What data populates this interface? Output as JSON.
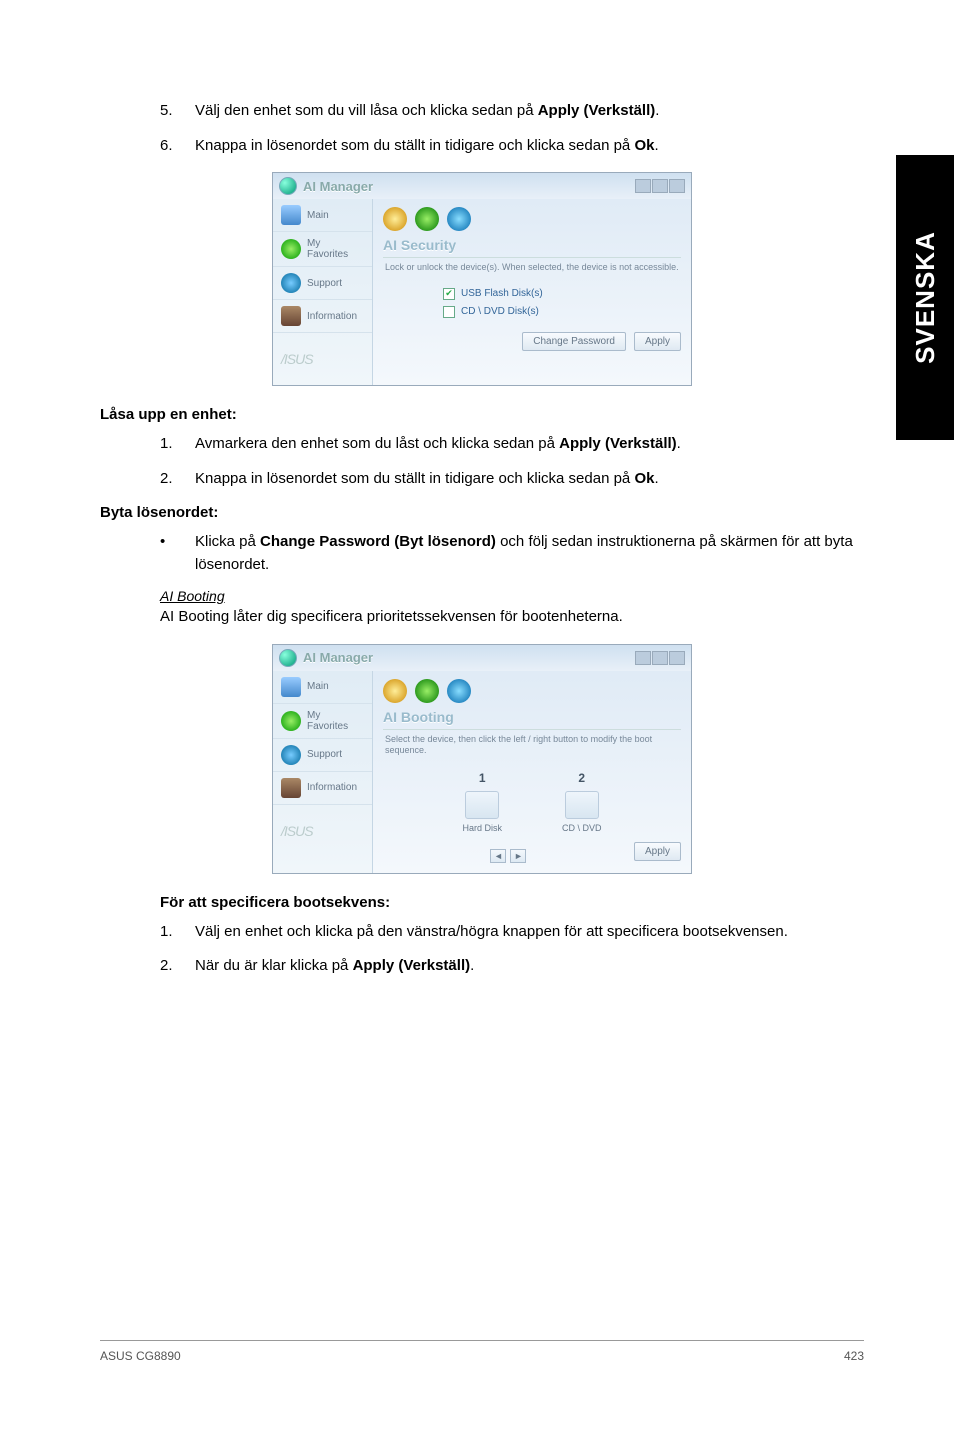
{
  "side_tab": "SVENSKA",
  "steps_top": [
    {
      "num": "5.",
      "pre": "Välj den enhet som du vill låsa och klicka sedan på ",
      "bold": "Apply (Verkställ)",
      "post": "."
    },
    {
      "num": "6.",
      "pre": "Knappa in lösenordet som du ställt in tidigare och klicka sedan på ",
      "bold": "Ok",
      "post": "."
    }
  ],
  "heading_unlock": "Låsa upp en enhet:",
  "steps_unlock": [
    {
      "num": "1.",
      "pre": "Avmarkera den enhet som du låst och klicka sedan på ",
      "bold": "Apply (Verkställ)",
      "post": "."
    },
    {
      "num": "2.",
      "pre": "Knappa in lösenordet som du ställt in tidigare och klicka sedan på ",
      "bold": "Ok",
      "post": "."
    }
  ],
  "heading_change": "Byta lösenordet:",
  "bullet_change": {
    "pre": "Klicka på ",
    "bold": "Change Password (Byt lösenord)",
    "post": " och följ sedan instruktionerna på skärmen för att byta lösenordet."
  },
  "ai_booting_title": "AI Booting",
  "ai_booting_desc": "AI Booting låter dig specificera prioritetssekvensen för bootenheterna.",
  "heading_bootseq": "För att specificera bootsekvens:",
  "steps_bootseq": [
    {
      "num": "1.",
      "text": "Välj en enhet och klicka på den vänstra/högra knappen för att specificera bootsekvensen."
    },
    {
      "num": "2.",
      "pre": "När du är klar klicka på ",
      "bold": "Apply (Verkställ)",
      "post": "."
    }
  ],
  "footer_left": "ASUS CG8890",
  "footer_right": "423",
  "win1": {
    "title": "AI Manager",
    "sidebar": [
      "Main",
      "My Favorites",
      "Support",
      "Information"
    ],
    "logo": "/ISUS",
    "section": "AI Security",
    "desc": "Lock or unlock the device(s). When selected, the device is not accessible.",
    "check1_label": "USB Flash Disk(s)",
    "check2_label": "CD \\ DVD Disk(s)",
    "btn1": "Change Password",
    "btn2": "Apply"
  },
  "win2": {
    "title": "AI Manager",
    "sidebar": [
      "Main",
      "My Favorites",
      "Support",
      "Information"
    ],
    "logo": "/ISUS",
    "section": "AI Booting",
    "desc": "Select the device, then click the left / right button to modify the boot sequence.",
    "col1_num": "1",
    "col1_label": "Hard Disk",
    "col2_num": "2",
    "col2_label": "CD \\ DVD",
    "arrow_left": "◄",
    "arrow_right": "►",
    "btn": "Apply"
  }
}
